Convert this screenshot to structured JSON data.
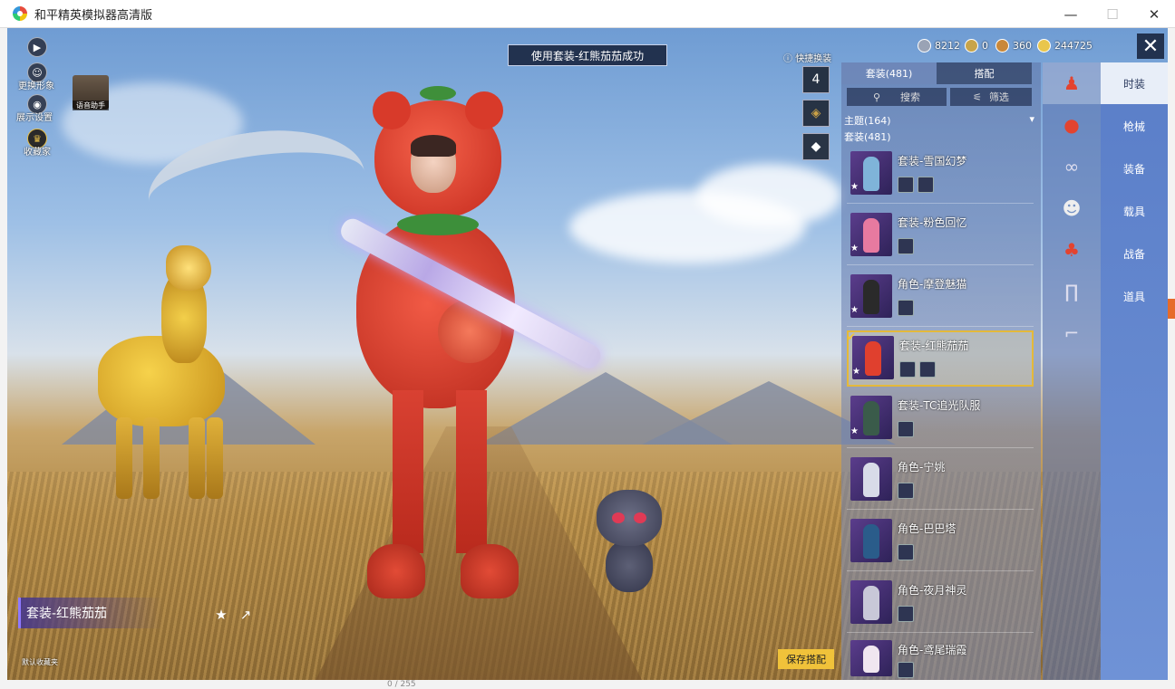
{
  "window": {
    "title": "和平精英模拟器高清版",
    "buttons": {
      "minimize": "—",
      "maximize": "☐",
      "close": "✕"
    }
  },
  "hud_left": {
    "play_icon": "▶",
    "change_look_label": "更换形象",
    "display_settings_label": "展示设置",
    "favorites_label": "收藏家",
    "voice_assistant_label": "语音助手"
  },
  "toast": "使用套装-红熊茄茄成功",
  "quick_swap": {
    "label": "快捷换装",
    "slot_count": "4"
  },
  "currency": [
    {
      "name": "silver-coupon",
      "value": "8212",
      "color": "#9aa3b5"
    },
    {
      "name": "token",
      "value": "0",
      "color": "#c7a44a"
    },
    {
      "name": "bronze-coin",
      "value": "360",
      "color": "#c9883a"
    },
    {
      "name": "gold-coin",
      "value": "244725",
      "color": "#e9c64c"
    }
  ],
  "panel": {
    "tabs": [
      "套装(481)",
      "搭配"
    ],
    "search_label": "搜索",
    "filter_label": "筛选",
    "theme_label": "主题(164)",
    "count_label": "套装(481)",
    "items": [
      {
        "name": "套装-雪国幻梦",
        "color": "#7fb4d9",
        "selected": false
      },
      {
        "name": "套装-粉色回忆",
        "color": "#e77aa0",
        "selected": false
      },
      {
        "name": "角色-摩登魅猫",
        "color": "#2a2a2a",
        "selected": false
      },
      {
        "name": "套装-红熊茄茄",
        "color": "#e0402e",
        "selected": true
      },
      {
        "name": "套装-TC追光队服",
        "color": "#3a5b4a",
        "selected": false
      },
      {
        "name": "角色-宁姚",
        "color": "#d8dbe8",
        "selected": false
      },
      {
        "name": "角色-巴巴塔",
        "color": "#2a5c8a",
        "selected": false
      },
      {
        "name": "角色-夜月神灵",
        "color": "#c8c8d8",
        "selected": false
      },
      {
        "name": "角色-鸢尾瑞霞",
        "color": "#f0e6f0",
        "selected": false
      }
    ]
  },
  "categories": [
    "outfit-icon",
    "tomato-pendant-icon",
    "glasses-icon",
    "mask-icon",
    "top-icon",
    "pants-icon",
    "shoes-icon"
  ],
  "section_tabs": [
    "时装",
    "枪械",
    "装备",
    "载具",
    "战备",
    "道具"
  ],
  "bottom": {
    "outfit_title": "套装-红熊茄茄",
    "default_favorites": "默认收藏夹",
    "save_button": "保存搭配"
  },
  "below_window_text": "0 / 255"
}
